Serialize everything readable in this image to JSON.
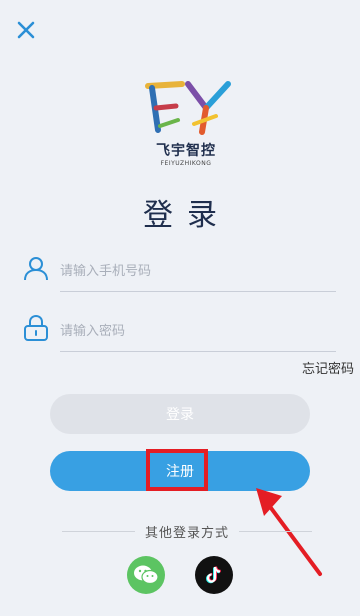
{
  "header": {
    "close_icon": "close-icon"
  },
  "logo": {
    "mark": "FY",
    "name_cn": "飞宇智控",
    "name_en": "FEIYUZHIKONG"
  },
  "page": {
    "title": "登录"
  },
  "form": {
    "phone_placeholder": "请输入手机号码",
    "phone_icon": "user-icon",
    "password_placeholder": "请输入密码",
    "password_icon": "lock-icon",
    "forgot_label": "忘记密码"
  },
  "actions": {
    "login_label": "登录",
    "register_label": "注册"
  },
  "social": {
    "divider_label": "其他登录方式",
    "items": [
      {
        "name": "wechat-icon",
        "color": "#5cc462"
      },
      {
        "name": "tiktok-icon",
        "color": "#111111"
      }
    ]
  },
  "annotation": {
    "highlight_color": "#e41d24"
  }
}
